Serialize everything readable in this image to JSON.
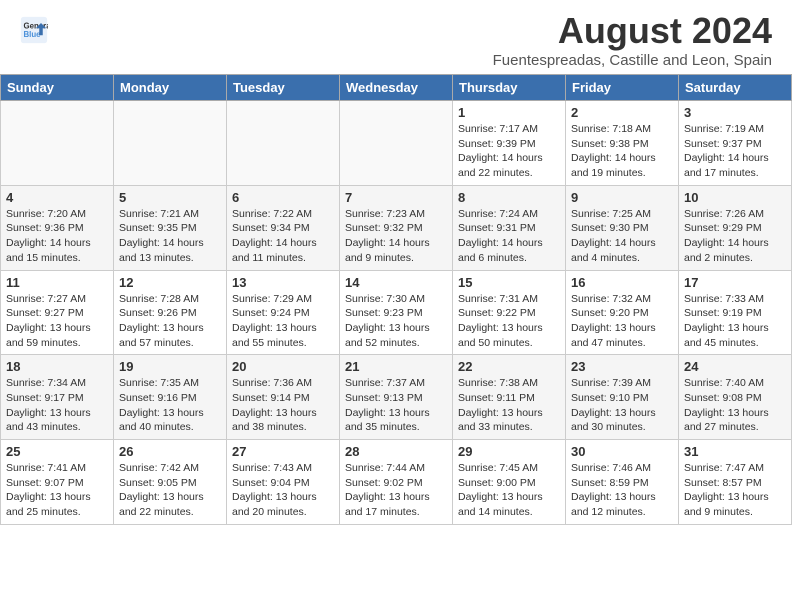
{
  "header": {
    "logo_line1": "General",
    "logo_line2": "Blue",
    "title": "August 2024",
    "subtitle": "Fuentespreadas, Castille and Leon, Spain"
  },
  "columns": [
    "Sunday",
    "Monday",
    "Tuesday",
    "Wednesday",
    "Thursday",
    "Friday",
    "Saturday"
  ],
  "weeks": [
    [
      {
        "day": "",
        "info": ""
      },
      {
        "day": "",
        "info": ""
      },
      {
        "day": "",
        "info": ""
      },
      {
        "day": "",
        "info": ""
      },
      {
        "day": "1",
        "info": "Sunrise: 7:17 AM\nSunset: 9:39 PM\nDaylight: 14 hours\nand 22 minutes."
      },
      {
        "day": "2",
        "info": "Sunrise: 7:18 AM\nSunset: 9:38 PM\nDaylight: 14 hours\nand 19 minutes."
      },
      {
        "day": "3",
        "info": "Sunrise: 7:19 AM\nSunset: 9:37 PM\nDaylight: 14 hours\nand 17 minutes."
      }
    ],
    [
      {
        "day": "4",
        "info": "Sunrise: 7:20 AM\nSunset: 9:36 PM\nDaylight: 14 hours\nand 15 minutes."
      },
      {
        "day": "5",
        "info": "Sunrise: 7:21 AM\nSunset: 9:35 PM\nDaylight: 14 hours\nand 13 minutes."
      },
      {
        "day": "6",
        "info": "Sunrise: 7:22 AM\nSunset: 9:34 PM\nDaylight: 14 hours\nand 11 minutes."
      },
      {
        "day": "7",
        "info": "Sunrise: 7:23 AM\nSunset: 9:32 PM\nDaylight: 14 hours\nand 9 minutes."
      },
      {
        "day": "8",
        "info": "Sunrise: 7:24 AM\nSunset: 9:31 PM\nDaylight: 14 hours\nand 6 minutes."
      },
      {
        "day": "9",
        "info": "Sunrise: 7:25 AM\nSunset: 9:30 PM\nDaylight: 14 hours\nand 4 minutes."
      },
      {
        "day": "10",
        "info": "Sunrise: 7:26 AM\nSunset: 9:29 PM\nDaylight: 14 hours\nand 2 minutes."
      }
    ],
    [
      {
        "day": "11",
        "info": "Sunrise: 7:27 AM\nSunset: 9:27 PM\nDaylight: 13 hours\nand 59 minutes."
      },
      {
        "day": "12",
        "info": "Sunrise: 7:28 AM\nSunset: 9:26 PM\nDaylight: 13 hours\nand 57 minutes."
      },
      {
        "day": "13",
        "info": "Sunrise: 7:29 AM\nSunset: 9:24 PM\nDaylight: 13 hours\nand 55 minutes."
      },
      {
        "day": "14",
        "info": "Sunrise: 7:30 AM\nSunset: 9:23 PM\nDaylight: 13 hours\nand 52 minutes."
      },
      {
        "day": "15",
        "info": "Sunrise: 7:31 AM\nSunset: 9:22 PM\nDaylight: 13 hours\nand 50 minutes."
      },
      {
        "day": "16",
        "info": "Sunrise: 7:32 AM\nSunset: 9:20 PM\nDaylight: 13 hours\nand 47 minutes."
      },
      {
        "day": "17",
        "info": "Sunrise: 7:33 AM\nSunset: 9:19 PM\nDaylight: 13 hours\nand 45 minutes."
      }
    ],
    [
      {
        "day": "18",
        "info": "Sunrise: 7:34 AM\nSunset: 9:17 PM\nDaylight: 13 hours\nand 43 minutes."
      },
      {
        "day": "19",
        "info": "Sunrise: 7:35 AM\nSunset: 9:16 PM\nDaylight: 13 hours\nand 40 minutes."
      },
      {
        "day": "20",
        "info": "Sunrise: 7:36 AM\nSunset: 9:14 PM\nDaylight: 13 hours\nand 38 minutes."
      },
      {
        "day": "21",
        "info": "Sunrise: 7:37 AM\nSunset: 9:13 PM\nDaylight: 13 hours\nand 35 minutes."
      },
      {
        "day": "22",
        "info": "Sunrise: 7:38 AM\nSunset: 9:11 PM\nDaylight: 13 hours\nand 33 minutes."
      },
      {
        "day": "23",
        "info": "Sunrise: 7:39 AM\nSunset: 9:10 PM\nDaylight: 13 hours\nand 30 minutes."
      },
      {
        "day": "24",
        "info": "Sunrise: 7:40 AM\nSunset: 9:08 PM\nDaylight: 13 hours\nand 27 minutes."
      }
    ],
    [
      {
        "day": "25",
        "info": "Sunrise: 7:41 AM\nSunset: 9:07 PM\nDaylight: 13 hours\nand 25 minutes."
      },
      {
        "day": "26",
        "info": "Sunrise: 7:42 AM\nSunset: 9:05 PM\nDaylight: 13 hours\nand 22 minutes."
      },
      {
        "day": "27",
        "info": "Sunrise: 7:43 AM\nSunset: 9:04 PM\nDaylight: 13 hours\nand 20 minutes."
      },
      {
        "day": "28",
        "info": "Sunrise: 7:44 AM\nSunset: 9:02 PM\nDaylight: 13 hours\nand 17 minutes."
      },
      {
        "day": "29",
        "info": "Sunrise: 7:45 AM\nSunset: 9:00 PM\nDaylight: 13 hours\nand 14 minutes."
      },
      {
        "day": "30",
        "info": "Sunrise: 7:46 AM\nSunset: 8:59 PM\nDaylight: 13 hours\nand 12 minutes."
      },
      {
        "day": "31",
        "info": "Sunrise: 7:47 AM\nSunset: 8:57 PM\nDaylight: 13 hours\nand 9 minutes."
      }
    ]
  ]
}
